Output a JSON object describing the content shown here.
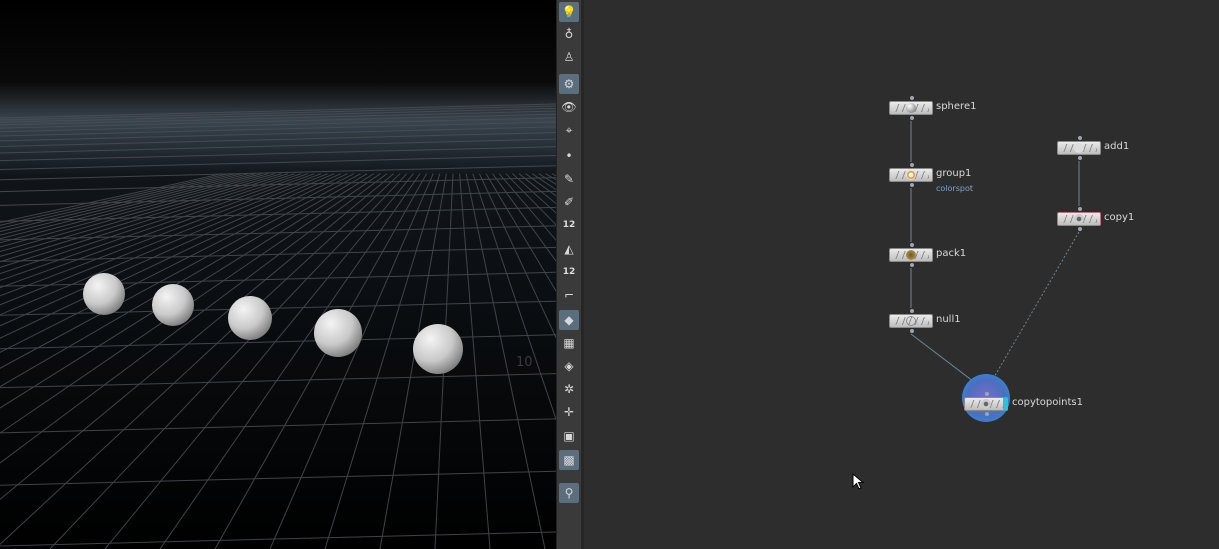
{
  "viewport": {
    "grid_labels": [
      "10"
    ]
  },
  "toolbar": {
    "tools": [
      {
        "icon": "lightbulb-icon",
        "active": true
      },
      {
        "icon": "light-icon"
      },
      {
        "icon": "camera-pin-icon"
      },
      {
        "icon": "display-options-icon",
        "active": true
      },
      {
        "icon": "visibility-icon"
      },
      {
        "icon": "camera-view-icon"
      },
      {
        "icon": "point-icon"
      },
      {
        "icon": "brush-icon"
      },
      {
        "icon": "pencil-icon"
      },
      {
        "icon": "point-numbers-icon",
        "label": "12"
      },
      {
        "icon": "paint-bucket-icon"
      },
      {
        "icon": "primitive-numbers-icon",
        "label": "12"
      },
      {
        "icon": "edge-icon"
      },
      {
        "icon": "shaded-icon",
        "active": true
      },
      {
        "icon": "checker-icon"
      },
      {
        "icon": "flat-shade-icon"
      },
      {
        "icon": "uv-icon"
      },
      {
        "icon": "origin-icon"
      },
      {
        "icon": "stop-icon"
      },
      {
        "icon": "background-image-icon",
        "active": true
      },
      {
        "icon": "pin-icon",
        "active": true
      }
    ]
  },
  "network": {
    "nodes": [
      {
        "id": "sphere1",
        "label": "sphere1",
        "icon": "sphere-icon"
      },
      {
        "id": "group1",
        "label": "group1",
        "comment": "colorspot",
        "icon": "group-icon"
      },
      {
        "id": "pack1",
        "label": "pack1",
        "icon": "pack-icon"
      },
      {
        "id": "null1",
        "label": "null1",
        "icon": "null-icon"
      },
      {
        "id": "add1",
        "label": "add1",
        "icon": "add-icon"
      },
      {
        "id": "copy1",
        "label": "copy1",
        "icon": "copy-icon"
      },
      {
        "id": "copytopoints1",
        "label": "copytopoints1",
        "icon": "copytopoints-icon",
        "display": true
      }
    ],
    "wires": [
      [
        "sphere1",
        "group1"
      ],
      [
        "group1",
        "pack1"
      ],
      [
        "pack1",
        "null1"
      ],
      [
        "null1",
        "copytopoints1"
      ],
      [
        "add1",
        "copy1"
      ],
      [
        "copy1",
        "copytopoints1"
      ]
    ]
  },
  "colors": {
    "wire": "#6f8696",
    "display_ring": "#3a7fd0",
    "comment": "#7ea6c8"
  }
}
